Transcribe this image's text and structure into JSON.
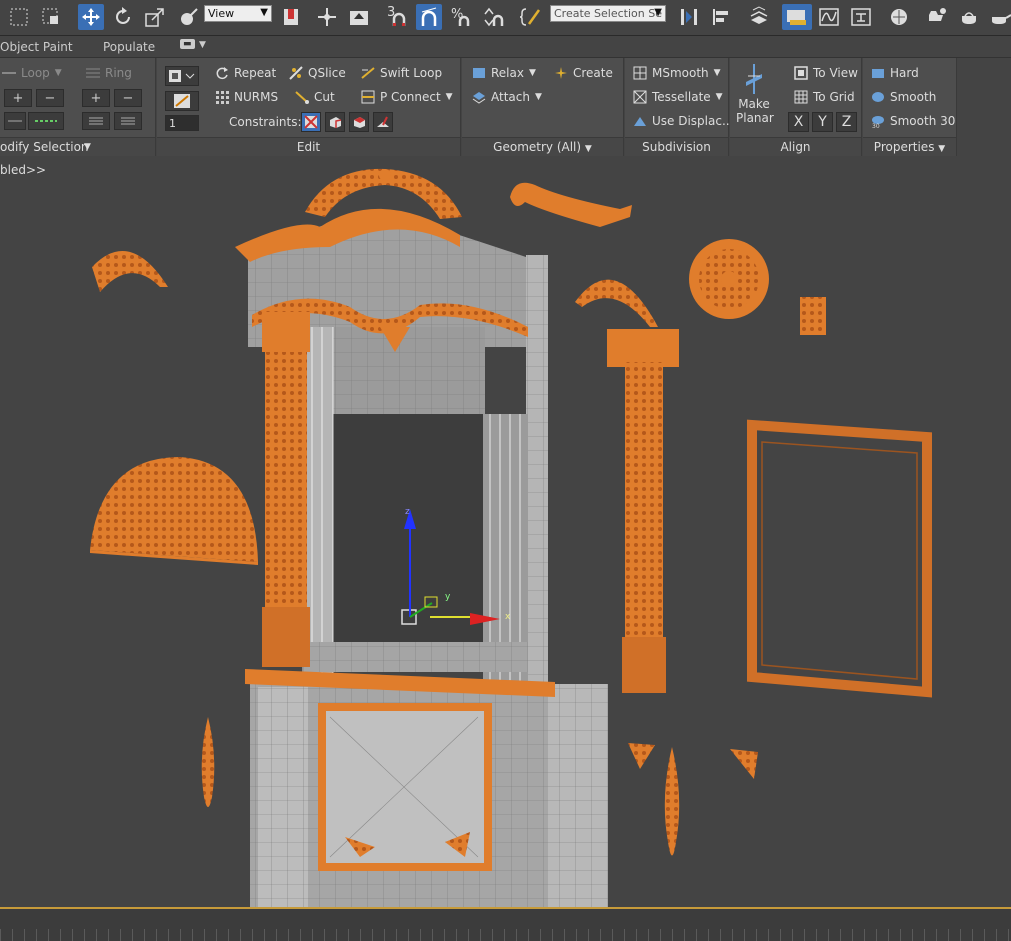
{
  "toolbar": {
    "view_select": "View",
    "selection_set_placeholder": "Create Selection Se",
    "snap_number": "3",
    "colors": {
      "active": "#3a6fb5",
      "bg": "#444444"
    }
  },
  "tabs": {
    "object_paint": "Object Paint",
    "populate": "Populate"
  },
  "ribbon": {
    "modify_selection": {
      "loop": "Loop",
      "ring": "Ring",
      "footer": "odify Selection"
    },
    "edit": {
      "repeat": "Repeat",
      "qslice": "QSlice",
      "swift_loop": "Swift Loop",
      "nurms": "NURMS",
      "cut": "Cut",
      "p_connect": "P Connect",
      "spinner_value": "1",
      "constraints": "Constraints:",
      "footer": "Edit"
    },
    "geometry": {
      "relax": "Relax",
      "create": "Create",
      "attach": "Attach",
      "footer": "Geometry (All)"
    },
    "subdivision": {
      "msmooth": "MSmooth",
      "tessellate": "Tessellate",
      "use_displace": "Use Displac...",
      "footer": "Subdivision"
    },
    "align": {
      "make_planar_1": "Make",
      "make_planar_2": "Planar",
      "to_view": "To View",
      "to_grid": "To Grid",
      "x": "X",
      "y": "Y",
      "z": "Z",
      "footer": "Align"
    },
    "properties": {
      "hard": "Hard",
      "smooth": "Smooth",
      "smooth30": "Smooth 30",
      "footer": "Properties"
    }
  },
  "viewport": {
    "label": "bled>>",
    "axis_x": "x",
    "axis_y": "y",
    "axis_z": "z",
    "colors": {
      "orange": "#e07d2c",
      "gray": "#9a9a9a"
    }
  }
}
